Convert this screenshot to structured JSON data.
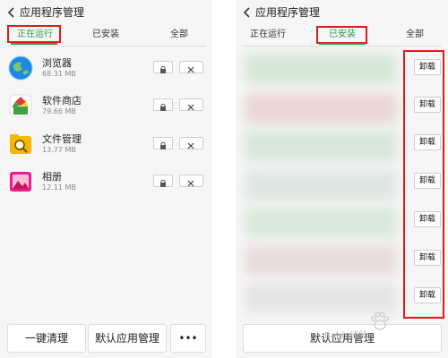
{
  "left": {
    "title": "应用程序管理",
    "tabs": [
      "正在运行",
      "已安装",
      "全部"
    ],
    "apps": [
      {
        "name": "浏览器",
        "size": "68.31 MB",
        "icon": "browser-icon"
      },
      {
        "name": "软件商店",
        "size": "79.66 MB",
        "icon": "app-store-icon"
      },
      {
        "name": "文件管理",
        "size": "13.77 MB",
        "icon": "file-manager-icon"
      },
      {
        "name": "相册",
        "size": "12.11 MB",
        "icon": "gallery-icon"
      }
    ],
    "bottom": {
      "clean": "一键清理",
      "default_apps": "默认应用管理",
      "more": "•••"
    }
  },
  "right": {
    "title": "应用程序管理",
    "tabs": [
      "正在运行",
      "已安装",
      "全部"
    ],
    "uninstall": [
      "卸载",
      "卸载",
      "卸载",
      "卸载",
      "卸载",
      "卸载",
      "卸载"
    ],
    "bottom": {
      "default_apps": "默认应用管理"
    }
  },
  "watermark": "Baidu经验",
  "colors": {
    "accent": "#2e9a4d",
    "highlight": "#e01b1b"
  }
}
